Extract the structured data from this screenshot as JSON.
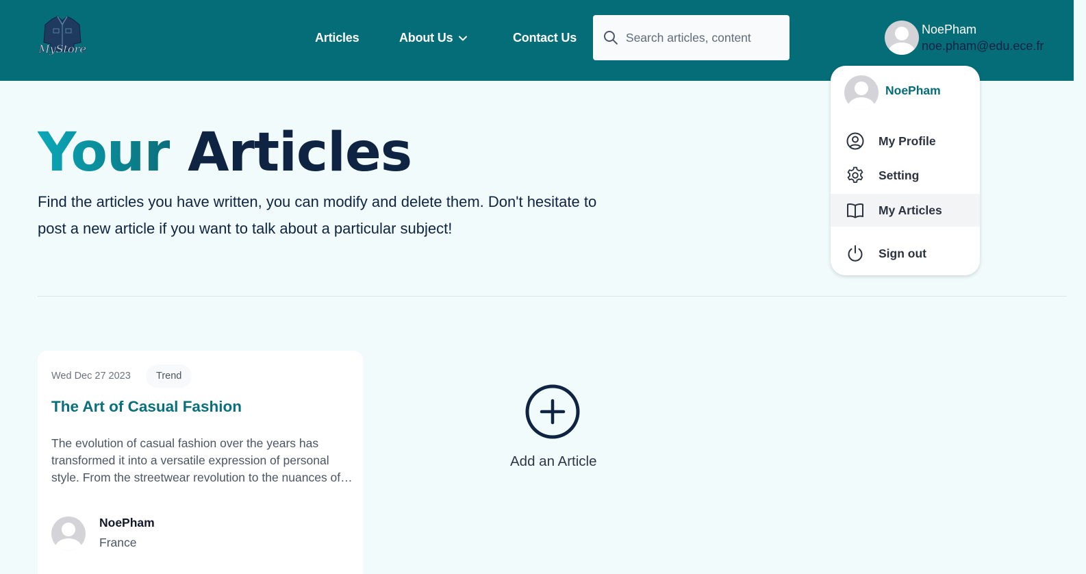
{
  "header": {
    "logo_text": "MyStore",
    "nav": [
      {
        "label": "Articles"
      },
      {
        "label": "About Us"
      },
      {
        "label": "Contact Us"
      }
    ],
    "search": {
      "placeholder": "Search articles, content",
      "value": ""
    },
    "user": {
      "name": "NoePham",
      "email": "noe.pham@edu.ece.fr"
    }
  },
  "dropdown": {
    "name": "NoePham",
    "items": [
      {
        "label": "My Profile",
        "icon": "user-circle-icon"
      },
      {
        "label": "Setting",
        "icon": "gear-icon"
      },
      {
        "label": "My Articles",
        "icon": "book-icon",
        "active": true
      },
      {
        "label": "Sign out",
        "icon": "power-icon"
      }
    ]
  },
  "page": {
    "title_part1": "Your",
    "title_part2": "Articles",
    "description": "Find the articles you have written, you can modify and delete them. Don't hesitate to post a new article if you want to talk about a particular subject!"
  },
  "articles": [
    {
      "date": "Wed Dec 27 2023",
      "tag": "Trend",
      "title": "The Art of Casual Fashion",
      "excerpt": "The evolution of casual fashion over the years has transformed it into a versatile expression of personal style. From the streetwear revolution to the nuances of casual wear in modern wardrobes, this article explores it all.",
      "author": {
        "name": "NoePham",
        "country": "France"
      }
    }
  ],
  "add_article": {
    "label": "Add an Article"
  },
  "colors": {
    "header_bg": "#046d78",
    "page_bg": "#f1fbfc",
    "accent": "#086f7b",
    "dark": "#0f2342"
  }
}
